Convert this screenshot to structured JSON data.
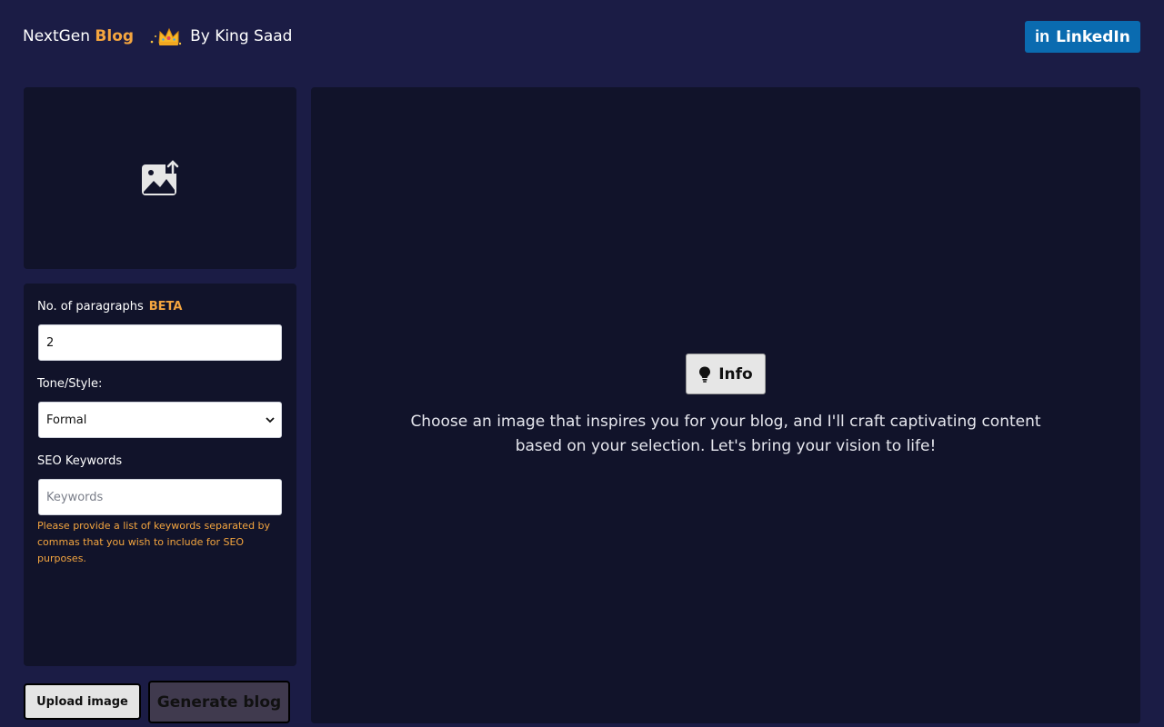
{
  "header": {
    "brand_name": "NextGen",
    "brand_accent": "Blog",
    "byline": "By King Saad",
    "linkedin_label": "LinkedIn",
    "linkedin_icon_text": "in"
  },
  "upload_area": {
    "icon": "image-upload-icon"
  },
  "form": {
    "paragraphs_label": "No. of paragraphs",
    "beta_badge": "BETA",
    "paragraphs_value": "2",
    "tone_label": "Tone/Style:",
    "tone_value": "Formal",
    "seo_label": "SEO Keywords",
    "seo_placeholder": "Keywords",
    "seo_hint": "Please provide a list of keywords separated by commas that you wish to include for SEO purposes."
  },
  "actions": {
    "upload_label": "Upload image",
    "generate_label": "Generate blog"
  },
  "main": {
    "info_label": "Info",
    "info_text": "Choose an image that inspires you for your blog, and I'll craft captivating content based on your selection. Let's bring your vision to life!"
  },
  "colors": {
    "background": "#1b1c45",
    "panel": "#11132a",
    "accent": "#f4a53f",
    "linkedin": "#0a6bb0"
  }
}
